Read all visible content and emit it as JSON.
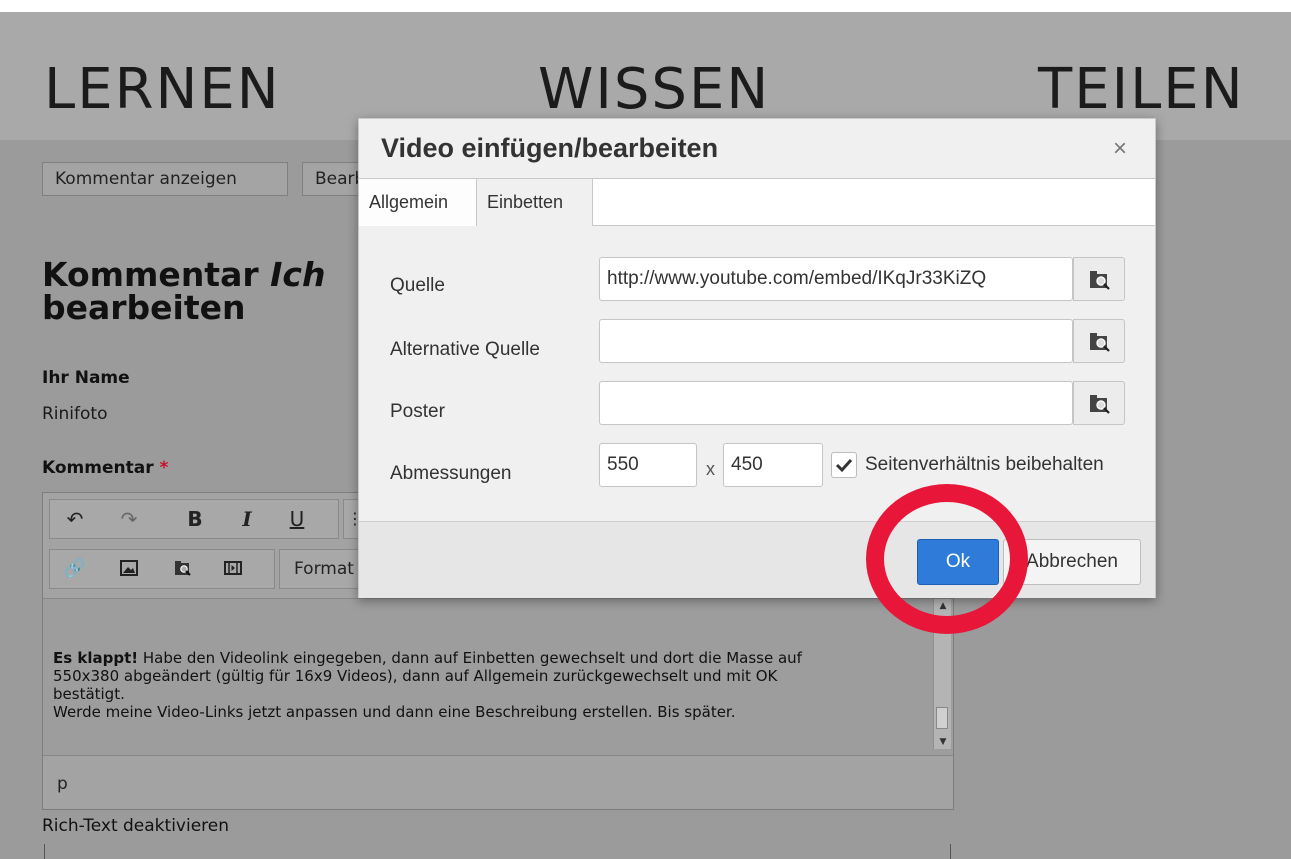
{
  "header": {
    "words": [
      "LERNEN",
      "WISSEN",
      "TEILEN"
    ]
  },
  "page": {
    "tabs": [
      "Kommentar anzeigen",
      "Bearbeiten"
    ],
    "heading_line1_a": "Kommentar ",
    "heading_line1_b": "Ich",
    "heading_line2": "bearbeiten",
    "name_label": "Ihr Name",
    "name_value": "Rinifoto",
    "comment_label": "Kommentar",
    "required_mark": "*",
    "format_label": "Format",
    "content": {
      "bold": "Es klappt!",
      "line1": " Habe den Videolink eingegeben, dann auf Einbetten gewechselt und dort die Masse auf",
      "line2": "550x380 abgeändert (gültig für 16x9 Videos), dann auf Allgemein zurückgewechselt und mit OK",
      "line3": "bestätigt.",
      "line4": "Werde meine Video-Links jetzt anpassen und dann eine Beschreibung erstellen. Bis später."
    },
    "path": "p",
    "richtext_toggle": "Rich-Text deaktivieren"
  },
  "modal": {
    "title": "Video einfügen/bearbeiten",
    "close": "×",
    "tabs": [
      "Allgemein",
      "Einbetten"
    ],
    "active_tab": "Allgemein",
    "fields": {
      "source_label": "Quelle",
      "source_value": "http://www.youtube.com/embed/IKqJr33KiZQ",
      "alt_source_label": "Alternative Quelle",
      "alt_source_value": "",
      "poster_label": "Poster",
      "poster_value": "",
      "dimensions_label": "Abmessungen",
      "width": "550",
      "separator": "x",
      "height": "450",
      "keep_ratio_label": "Seitenverhältnis beibehalten",
      "keep_ratio_checked": true
    },
    "ok_label": "Ok",
    "cancel_label": "Abbrechen"
  },
  "colors": {
    "ok_button": "#2f7bd9",
    "highlight_ring": "#e8173a"
  },
  "icons": [
    "undo-icon",
    "redo-icon",
    "bold-icon",
    "italic-icon",
    "underline-icon",
    "link-icon",
    "image-icon",
    "browse-icon",
    "media-icon",
    "close-icon",
    "checkmark-icon"
  ]
}
